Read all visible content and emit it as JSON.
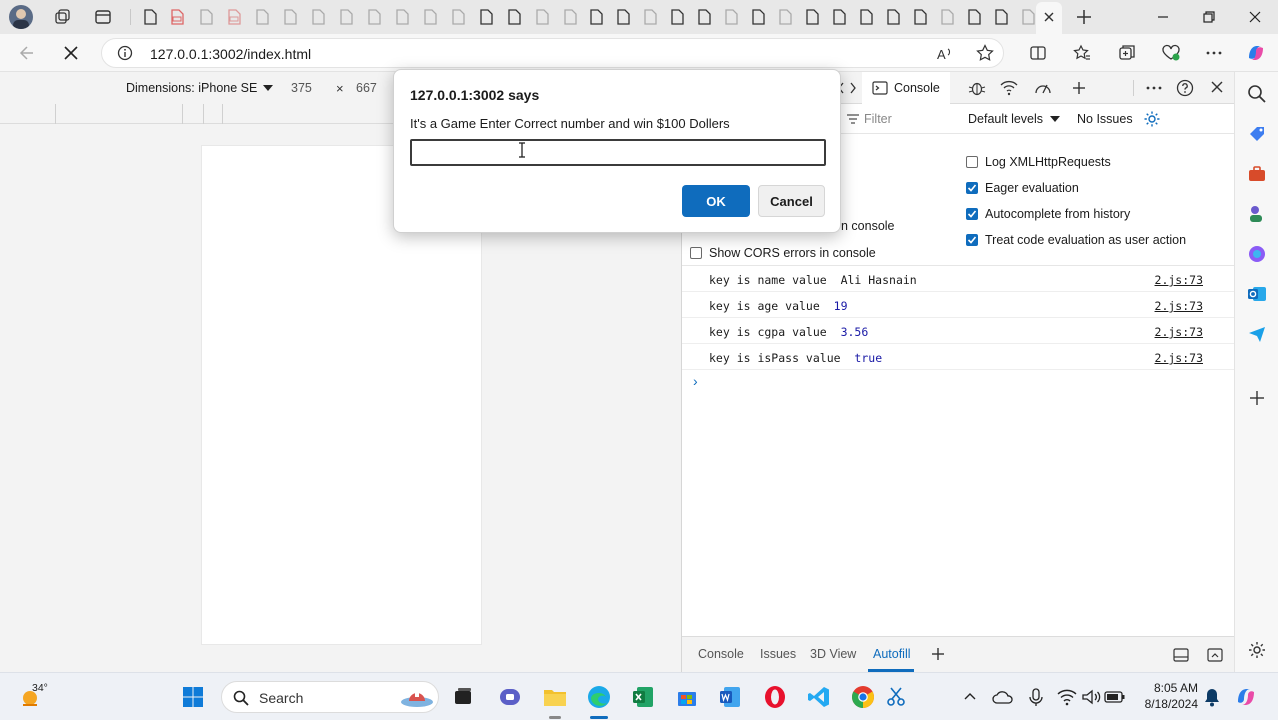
{
  "browser": {
    "url": "127.0.0.1:3002/index.html",
    "accent": "#0f6cbd"
  },
  "device_toolbar": {
    "dimensions_label": "Dimensions: iPhone SE",
    "width": "375",
    "times": "×",
    "height": "667"
  },
  "devtools": {
    "console_tab": "Console",
    "filter_placeholder": "Filter",
    "levels": "Default levels",
    "issues": "No Issues",
    "settings": {
      "partial_label": "n console",
      "cors": "Show CORS errors in console",
      "xhr": "Log XMLHttpRequests",
      "eager": "Eager evaluation",
      "autocomplete": "Autocomplete from history",
      "treat": "Treat code evaluation as user action"
    },
    "logs": [
      {
        "text": "key is name value",
        "value": "Ali Hasnain",
        "source": "2.js:73"
      },
      {
        "text": "key is age value",
        "value": "19",
        "source": "2.js:73"
      },
      {
        "text": "key is cgpa value",
        "value": "3.56",
        "source": "2.js:73"
      },
      {
        "text": "key is isPass value",
        "value": "true",
        "source": "2.js:73"
      }
    ],
    "prompt": "›",
    "drawer_tabs": [
      "Console",
      "Issues",
      "3D View",
      "Autofill"
    ]
  },
  "dialog": {
    "title": "127.0.0.1:3002 says",
    "message": "It's a Game Enter Correct number and win $100 Dollers",
    "input_value": "",
    "ok_label": "OK",
    "cancel_label": "Cancel"
  },
  "taskbar": {
    "weather": "34°",
    "search_label": "Search",
    "time": "8:05 AM",
    "date": "8/18/2024"
  }
}
